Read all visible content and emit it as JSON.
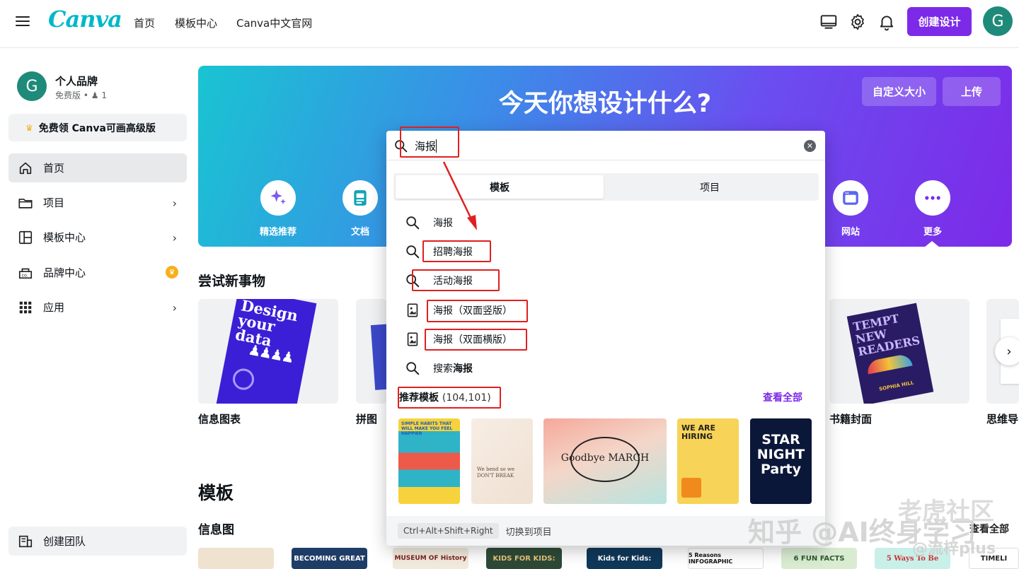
{
  "topbar": {
    "logo": "Canva",
    "nav": [
      "首页",
      "模板中心",
      "Canva中文官网"
    ],
    "create_btn": "创建设计",
    "avatar": "G"
  },
  "sidebar": {
    "avatar": "G",
    "brand_name": "个人品牌",
    "brand_plan": "免费版",
    "brand_members": "1",
    "promo": "免费领 Canva可画高级版",
    "items": [
      {
        "label": "首页"
      },
      {
        "label": "项目"
      },
      {
        "label": "模板中心"
      },
      {
        "label": "品牌中心"
      },
      {
        "label": "应用"
      }
    ],
    "team_btn": "创建团队"
  },
  "hero": {
    "title": "今天你想设计什么?",
    "custom_size": "自定义大小",
    "upload": "上传",
    "categories": [
      "精选推荐",
      "文档",
      "网站",
      "更多"
    ]
  },
  "sections": {
    "try_new": "尝试新事物",
    "templates": "模板",
    "infographic": "信息图",
    "view_all": "查看全部"
  },
  "cards": {
    "labels": [
      "信息图表",
      "拼图",
      "书籍封面",
      "思维导"
    ],
    "design_your_data": "Design your data",
    "tempt_new_readers": "TEMPT NEW READERS",
    "book_author": "SOPHIA HILL"
  },
  "bottom_templates": [
    "",
    "BECOMING GREAT",
    "MUSEUM OF History",
    "KIDS FOR KIDS:",
    "Kids for Kids:",
    "5 Reasons INFOGRAPHIC",
    "6 FUN FACTS",
    "5 Ways To Be",
    "TIMELI"
  ],
  "search": {
    "query": "海报",
    "tabs": [
      "模板",
      "项目"
    ],
    "suggestions": [
      {
        "text": "海报",
        "icon": "search-icon"
      },
      {
        "text": "招聘海报",
        "icon": "search-icon"
      },
      {
        "text": "活动海报",
        "icon": "search-icon"
      },
      {
        "text": "海报（双面竖版）",
        "icon": "design-type-icon"
      },
      {
        "text": "海报（双面横版）",
        "icon": "design-type-icon"
      }
    ],
    "search_prefix": "搜索",
    "search_term": "海报",
    "recommended_label": "推荐模板",
    "recommended_count": "(104,101)",
    "view_all": "查看全部",
    "thumbs": [
      "SIMPLE HABITS THAT WILL MAKE YOU FEEL HAPPIER",
      "We bend so we DON'T BREAK",
      "Goodbye MARCH",
      "WE ARE HIRING",
      "STAR NIGHT Party"
    ],
    "shortcut": "Ctrl+Alt+Shift+Right",
    "shortcut_hint": "切换到项目"
  },
  "watermark": {
    "line1": "知乎 @AI终身学习",
    "line2": "老虎社区",
    "line3": "@流梓plus"
  },
  "colors": {
    "accent": "#7d2ae8",
    "teal": "#00b8c9",
    "highlight": "#e02020"
  }
}
